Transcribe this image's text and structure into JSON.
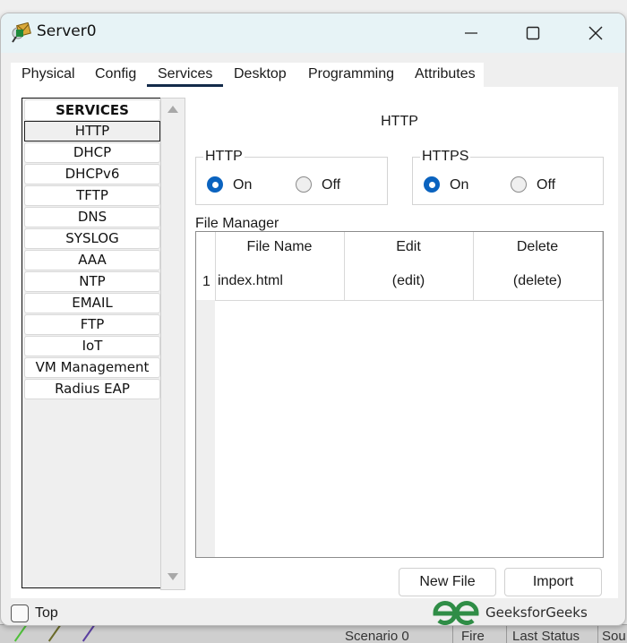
{
  "window": {
    "title": "Server0",
    "icon": "server-envelope-icon",
    "controls": {
      "minimize": "minimize-icon",
      "maximize": "maximize-icon",
      "close": "close-icon"
    }
  },
  "tabs": [
    {
      "label": "Physical",
      "active": false
    },
    {
      "label": "Config",
      "active": false
    },
    {
      "label": "Services",
      "active": true
    },
    {
      "label": "Desktop",
      "active": false
    },
    {
      "label": "Programming",
      "active": false
    },
    {
      "label": "Attributes",
      "active": false
    }
  ],
  "services": {
    "header": "SERVICES",
    "items": [
      "HTTP",
      "DHCP",
      "DHCPv6",
      "TFTP",
      "DNS",
      "SYSLOG",
      "AAA",
      "NTP",
      "EMAIL",
      "FTP",
      "IoT",
      "VM Management",
      "Radius EAP"
    ],
    "selected": "HTTP"
  },
  "panel": {
    "title": "HTTP",
    "http_group": {
      "label": "HTTP",
      "on_label": "On",
      "off_label": "Off",
      "value": "On"
    },
    "https_group": {
      "label": "HTTPS",
      "on_label": "On",
      "off_label": "Off",
      "value": "On"
    },
    "file_manager": {
      "label": "File Manager",
      "columns": [
        "File Name",
        "Edit",
        "Delete"
      ],
      "rows": [
        {
          "index": "1",
          "file_name": "index.html",
          "edit": "(edit)",
          "delete": "(delete)"
        }
      ]
    },
    "buttons": {
      "new_file": "New File",
      "import": "Import"
    }
  },
  "footer": {
    "top_label": "Top",
    "top_checked": false,
    "watermark": "GeeksforGeeks",
    "accent_color": "#2f8d46"
  },
  "background": {
    "scenario": "Scenario 0",
    "col1": "Fire",
    "col2": "Last Status",
    "col3": "Sou"
  }
}
